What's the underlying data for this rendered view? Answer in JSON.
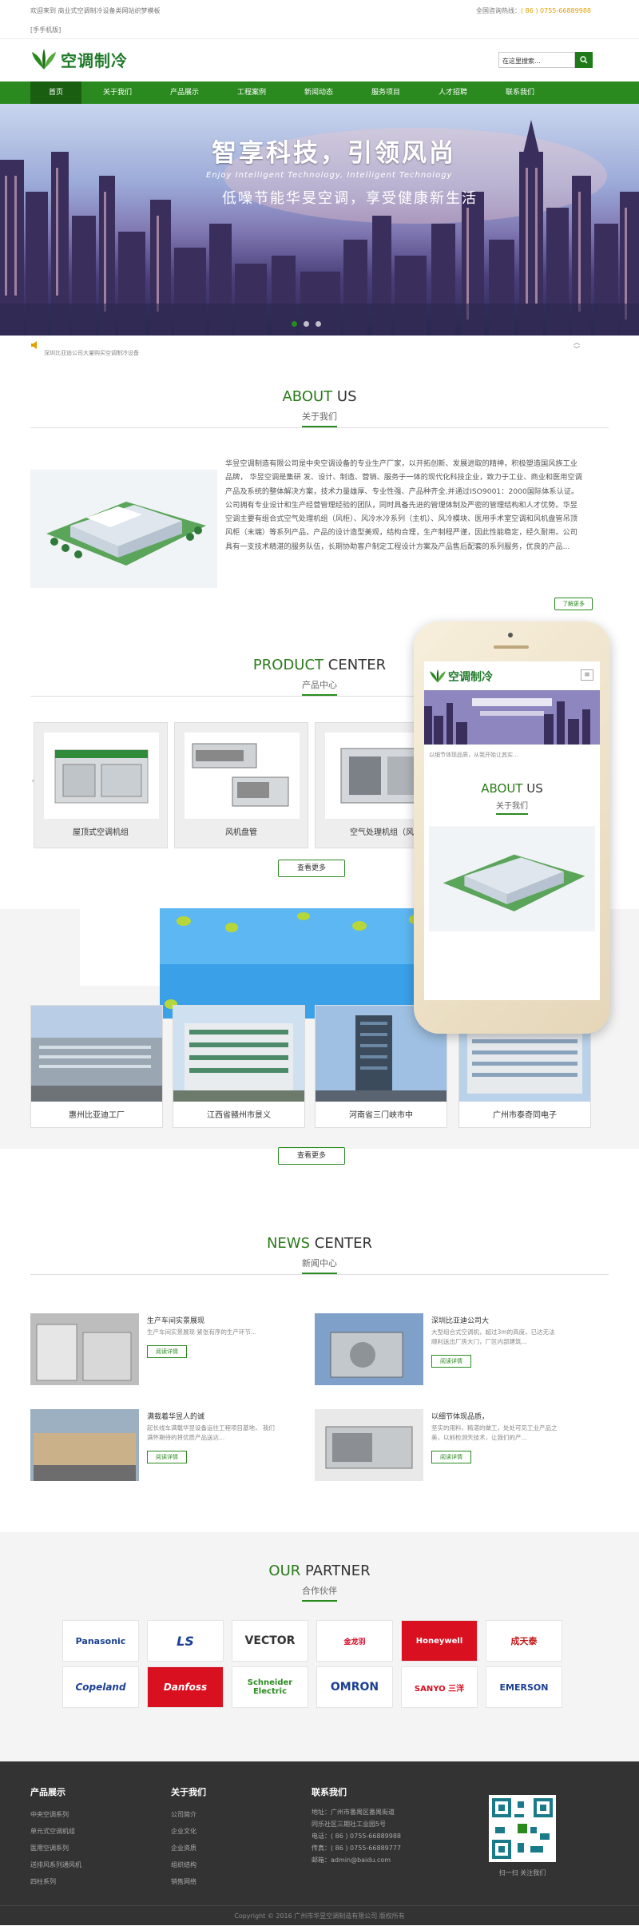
{
  "topbar": {
    "welcome": "欢迎来到 商业式空调制冷设备类网站织梦模板",
    "mobile": "[手手机版]",
    "hotline_label": "全国咨询热线：",
    "hotline": "( 86 ) 0755-66889988"
  },
  "logo": {
    "text": "空调制冷"
  },
  "search": {
    "placeholder": "在这里搜索..."
  },
  "nav": {
    "items": [
      "首页",
      "关于我们",
      "产品展示",
      "工程案例",
      "新闻动态",
      "服务项目",
      "人才招聘",
      "联系我们"
    ]
  },
  "banner": {
    "title": "智享科技，引领风尚",
    "subtitle_en": "Enjoy Intelligent Technology, Intelligent Technology",
    "subtitle_cn": "低噪节能华旻空调，享受健康新生活"
  },
  "notice": {
    "text": "深圳比亚迪公司大量购买空调制冷设备"
  },
  "about": {
    "en_1": "ABOUT",
    "en_2": "US",
    "cn": "关于我们",
    "text": "华昱空调制造有限公司是中央空调设备的专业生产厂家，以开拓创新、发展进取的精神，积极塑造国风族工业品牌， 华昱空调是集研 发、设计、制造、营销、服务于一体的现代化科技企业，致力于工业、商业和医用空调产品及系统的整体解决方案，技术力量雄厚、专业性强、产品种齐全,并通过ISO9001：2000国际体系认证。公司拥有专业设计和生产经营管理经验的团队，同时具备先进的管理体制及严密的管理结构和人才优势。华昱空调主要有组合式空气处理机组（风柜）、风冷水冷系列（主机）、风冷模块、医用手术室空调和风机盘管吊顶风柜（末端）等系列产品，产品的设计造型美观，结构合理，生产制程严谨，因此性能稳定，经久耐用。公司具有一支技术精湛的服务队伍，长期协助客户制定工程设计方案及产品售后配套的系列服务，优良的产品...",
    "more": "了解更多"
  },
  "products": {
    "en_1": "PRODUCT",
    "en_2": "CENTER",
    "cn": "产品中心",
    "items": [
      "屋顶式空调机组",
      "风机盘管",
      "空气处理机组（风"
    ],
    "more": "查看更多"
  },
  "cases": {
    "items": [
      "惠州比亚迪工厂",
      "江西省赣州市景义",
      "河南省三门峡市中",
      "广州市泰奇同电子"
    ],
    "more": "查看更多"
  },
  "news": {
    "en_1": "NEWS",
    "en_2": "CENTER",
    "cn": "新闻中心",
    "items": [
      {
        "title": "生产车间实景展现",
        "desc": "生产车间实景展现·紧张有序的生产环节...",
        "btn": "阅读详情"
      },
      {
        "title": "深圳比亚迪公司大",
        "desc": "大型组合式空调机，超过3m的高度，已达无法顺利送出厂房大门，厂区内部建筑...",
        "btn": "阅读详情"
      },
      {
        "title": "满载着华昱人的诚",
        "desc": "起长线车满载华昱设备运往工程项目基地， 我们满怀期待的将优质产品送达...",
        "btn": "阅读详情"
      },
      {
        "title": "以细节体现品质，",
        "desc": "坚实的用料，精湛的做工，处处可见工业产品之美，以前检测天技术，让我们的产...",
        "btn": "阅读详情"
      }
    ]
  },
  "partners": {
    "en_1": "OUR",
    "en_2": "PARTNER",
    "cn": "合作伙伴",
    "logos": [
      "Panasonic",
      "LS",
      "VECTOR",
      "金龙羽",
      "Honeywell",
      "成天泰",
      "Copeland",
      "Danfoss",
      "Schneider Electric",
      "OMRON",
      "SANYO 三洋",
      "EMERSON"
    ]
  },
  "footer": {
    "col1": {
      "title": "产品展示",
      "items": [
        "中央空调系列",
        "单元式空调机组",
        "医用空调系列",
        "送排风系列通风机",
        "四柱系列"
      ]
    },
    "col2": {
      "title": "关于我们",
      "items": [
        "公司简介",
        "企业文化",
        "企业资质",
        "组织结构",
        "销售网络"
      ]
    },
    "col3": {
      "title": "联系我们",
      "items": [
        "地址：广州市番禺区番禺街道",
        "同乐社区三期社工业园5号",
        "电话：( 86 ) 0755-66889988",
        "传真：( 86 ) 0755-66889777",
        "邮箱：admin@baidu.com"
      ]
    },
    "qr_caption": "扫一扫 关注我们",
    "copyright": "Copyright © 2016 广州市华昱空调制造有限公司 版权所有"
  },
  "phone": {
    "logo": "空调制冷",
    "notice": "以细节体现品质，从我开始让其实..."
  },
  "colors": {
    "brand": "#2a8a1f",
    "nav_active": "#1a5e12",
    "footer": "#333333",
    "hotline": "#e0a000"
  }
}
